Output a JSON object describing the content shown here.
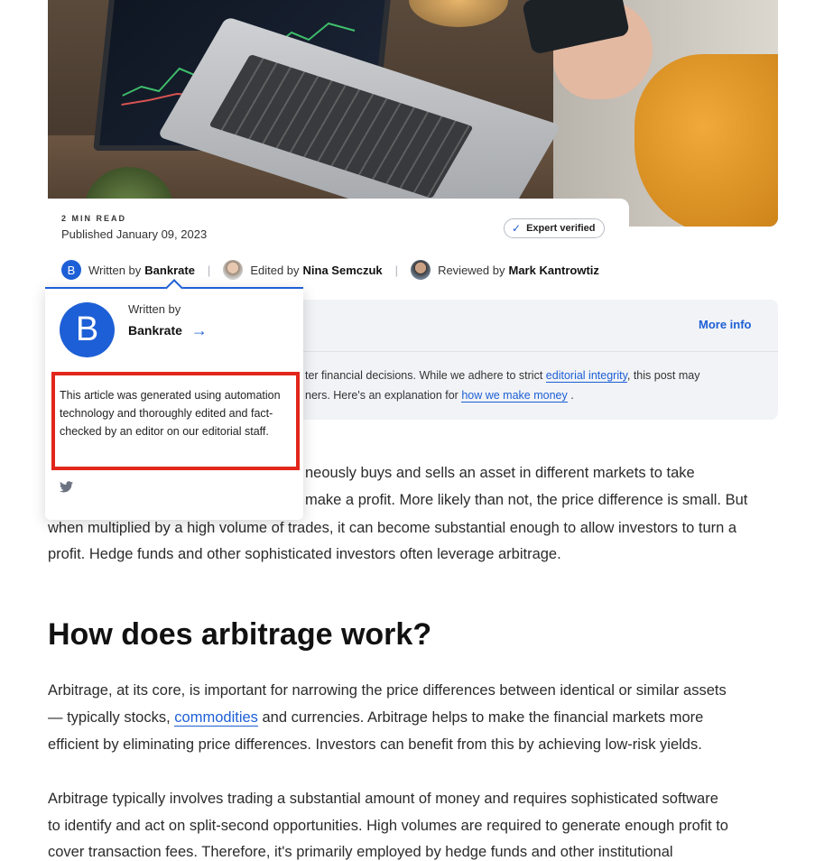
{
  "article": {
    "read_time": "2 MIN READ",
    "published": "Published January 09, 2023",
    "expert_badge": "Expert verified",
    "bylines": {
      "written_prefix": "Written by",
      "written_name": "Bankrate",
      "written_avatar_letter": "B",
      "edited_prefix": "Edited by",
      "edited_name": "Nina Semczuk",
      "reviewed_prefix": "Reviewed by",
      "reviewed_name": "Mark Kantrowtiz"
    }
  },
  "info_box": {
    "more_info": "More info",
    "line1_pre": "ter financial decisions. While we adhere to strict ",
    "line1_link": "editorial integrity",
    "line1_post": ", this post may",
    "line2_pre": "ners. Here's an explanation for ",
    "line2_link": "how we make money",
    "line2_post": " ."
  },
  "popover": {
    "written_by": "Written by",
    "name": "Bankrate",
    "avatar_letter": "B",
    "arrow": "→",
    "description": "This article was generated using automation technology and thoroughly edited and fact-checked by an editor on our editorial staff.",
    "twitter_icon": "twitter-icon"
  },
  "body": {
    "p1_line1": "neously buys and sells an asset in different markets to take",
    "p1_line2": "make a profit. More likely than not, the price difference is small. But",
    "p1_line3": "when multiplied by a high volume of trades, it can become substantial enough to allow investors to turn a",
    "p1_line4": "profit. Hedge funds and other sophisticated investors often leverage arbitrage.",
    "heading": "How does arbitrage work?",
    "p2_line1": "Arbitrage, at its core, is important for narrowing the price differences between identical or similar assets",
    "p2_line2_pre": "— typically stocks, ",
    "p2_line2_link": "commodities",
    "p2_line2_post": " and currencies. Arbitrage helps to make the financial markets more",
    "p2_line3": "efficient by eliminating price differences. Investors can benefit from this by achieving low-risk yields.",
    "p3_line1": "Arbitrage typically involves trading a substantial amount of money and requires sophisticated software",
    "p3_line2": "to identify and act on split-second opportunities. High volumes are required to generate enough profit to",
    "p3_line3": "cover transaction fees. Therefore, it's primarily employed by hedge funds and other institutional"
  },
  "colors": {
    "accent": "#1d5fd6",
    "highlight": "#e2261b"
  }
}
